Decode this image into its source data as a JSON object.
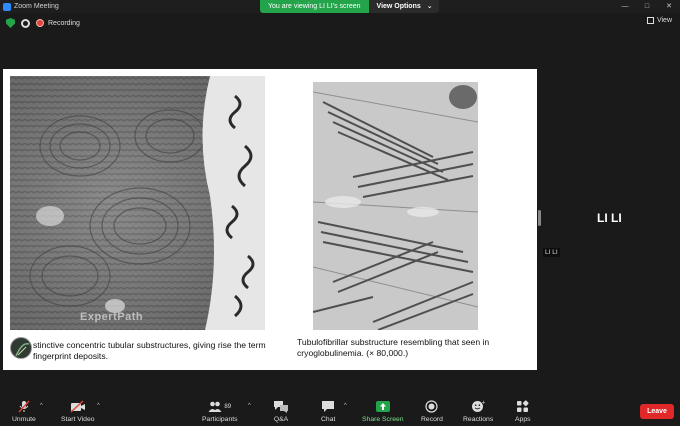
{
  "window": {
    "app_title": "Zoom Meeting",
    "controls": [
      "—",
      "□",
      "✕"
    ]
  },
  "banner": {
    "viewing_text": "You are viewing LI LI's screen",
    "view_options_label": "View Options",
    "view_options_caret": "⌄"
  },
  "status": {
    "recording_label": "Recording",
    "view_label": "View"
  },
  "slide": {
    "caption_left": "stinctive concentric tubular substructures, giving rise the term fingerprint deposits.",
    "caption_right": "Tubulofibrillar substructure resembling that seen in cryoglobulinemia. (× 80,000.)",
    "watermark": "ExpertPath"
  },
  "participant": {
    "name": "LI LI",
    "tag": "LI LI"
  },
  "toolbar": {
    "unmute_label": "Unmute",
    "start_video_label": "Start Video",
    "participants_label": "Participants",
    "participants_count": "89",
    "qa_label": "Q&A",
    "chat_label": "Chat",
    "share_screen_label": "Share Screen",
    "record_label": "Record",
    "reactions_label": "Reactions",
    "apps_label": "Apps",
    "leave_label": "Leave",
    "caret": "^"
  },
  "colors": {
    "share_green": "#23a44a",
    "leave_red": "#e02828",
    "mute_red": "#e0453a"
  }
}
